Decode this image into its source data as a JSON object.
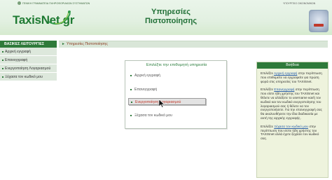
{
  "header": {
    "ministry_text": "ΓΕΝΙΚΗ ΓΡΑΜΜΑΤΕΙΑ ΠΛΗΡΟΦΟΡΙΑΚΩΝ ΣΥΣΤΗΜΑΤΩΝ",
    "logo_main": "TaxisNet",
    "logo_suffix": ".gr",
    "title_line1": "Υπηρεσίες",
    "title_line2": "Πιστοποίησης",
    "top_right_text": "ΥΠΟΥΡΓΕΙΟ ΟΙΚΟΝΟΜΙΚΩΝ"
  },
  "sidebar": {
    "heading": "ΒΑΣΙΚΕΣ ΛΕΙΤΟΥΡΓΙΕΣ",
    "items": [
      {
        "label": "Αρχική εγγραφή"
      },
      {
        "label": "Επανεγγραφή"
      },
      {
        "label": "Ενεργοποίηση Λογαριασμού"
      },
      {
        "label": "Ξέχασα τον κωδικό μου"
      }
    ]
  },
  "breadcrumb": {
    "text": "Υπηρεσίες Πιστοποίησης"
  },
  "dialog": {
    "title": "Επιλέξτε την επιθυμητή υπηρεσία",
    "options": [
      {
        "label": "Αρχική εγγραφή"
      },
      {
        "label": "Επανεγγραφή"
      },
      {
        "label": "Ενεργοποίηση Λογαριασμού"
      },
      {
        "label": "Ξέχασα τον κωδικό μου"
      }
    ],
    "highlighted_index": 2
  },
  "help": {
    "heading": "Βοήθεια",
    "p1_pre": "Επιλέξτε",
    "p1_link": "Αρχική εγγραφή",
    "p1_post": "στην περίπτωση που επιθυμείτε να εγγραφείτε για πρώτη φορά στις υπηρεσίες του TAXISnet.",
    "p2_pre": "Επιλέξτε",
    "p2_link": "Επανεγγραφή",
    "p2_post": "στην περίπτωση που είστε ήδη χρήστης του TAXISnet και θέλετε να αλλάξετε το username και/ή τον κωδικό και τον κωδικό ενεργοποίησης του λογαριασμού σας ή θέλετε να τον ενεργοποιήσετε. Για την επανεγγραφή σας θα ακολουθήσετε την ίδια διαδικασία με αυτή της αρχικής εγγραφής.",
    "p3_pre": "Επιλέξτε",
    "p3_link": "Ξέχασα τον κωδικό μου",
    "p3_post": "στην περίπτωση που είστε ήδη χρήστης του TAXISnet αλλά έχετε ξεχάσει τον κωδικό σας."
  },
  "colors": {
    "brand_green": "#2f7a3a",
    "title_green": "#1f6f35",
    "breadcrumb_text": "#8a3b1f",
    "highlight_text": "#c0392b",
    "link_blue": "#2a5fa8"
  }
}
